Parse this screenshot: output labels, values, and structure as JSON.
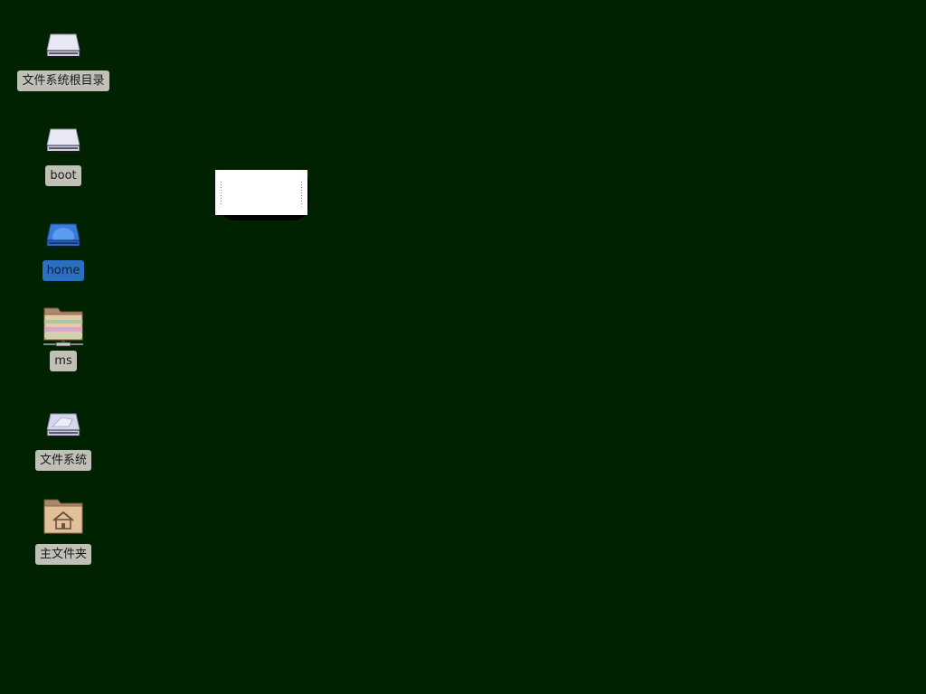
{
  "desktop": {
    "background_color": "#002200",
    "icons": [
      {
        "label": "文件系统根目录",
        "icon": "drive-icon",
        "selected": false
      },
      {
        "label": "boot",
        "icon": "drive-icon",
        "selected": false
      },
      {
        "label": "home",
        "icon": "drive-icon",
        "selected": true
      },
      {
        "label": "ms",
        "icon": "network-folder-icon",
        "selected": false
      },
      {
        "label": "文件系统",
        "icon": "harddisk-icon",
        "selected": false
      },
      {
        "label": "主文件夹",
        "icon": "home-folder-icon",
        "selected": false
      }
    ]
  },
  "colors": {
    "label_bg": "#c0c0b8",
    "label_selected_bg": "#2a6fc0"
  }
}
